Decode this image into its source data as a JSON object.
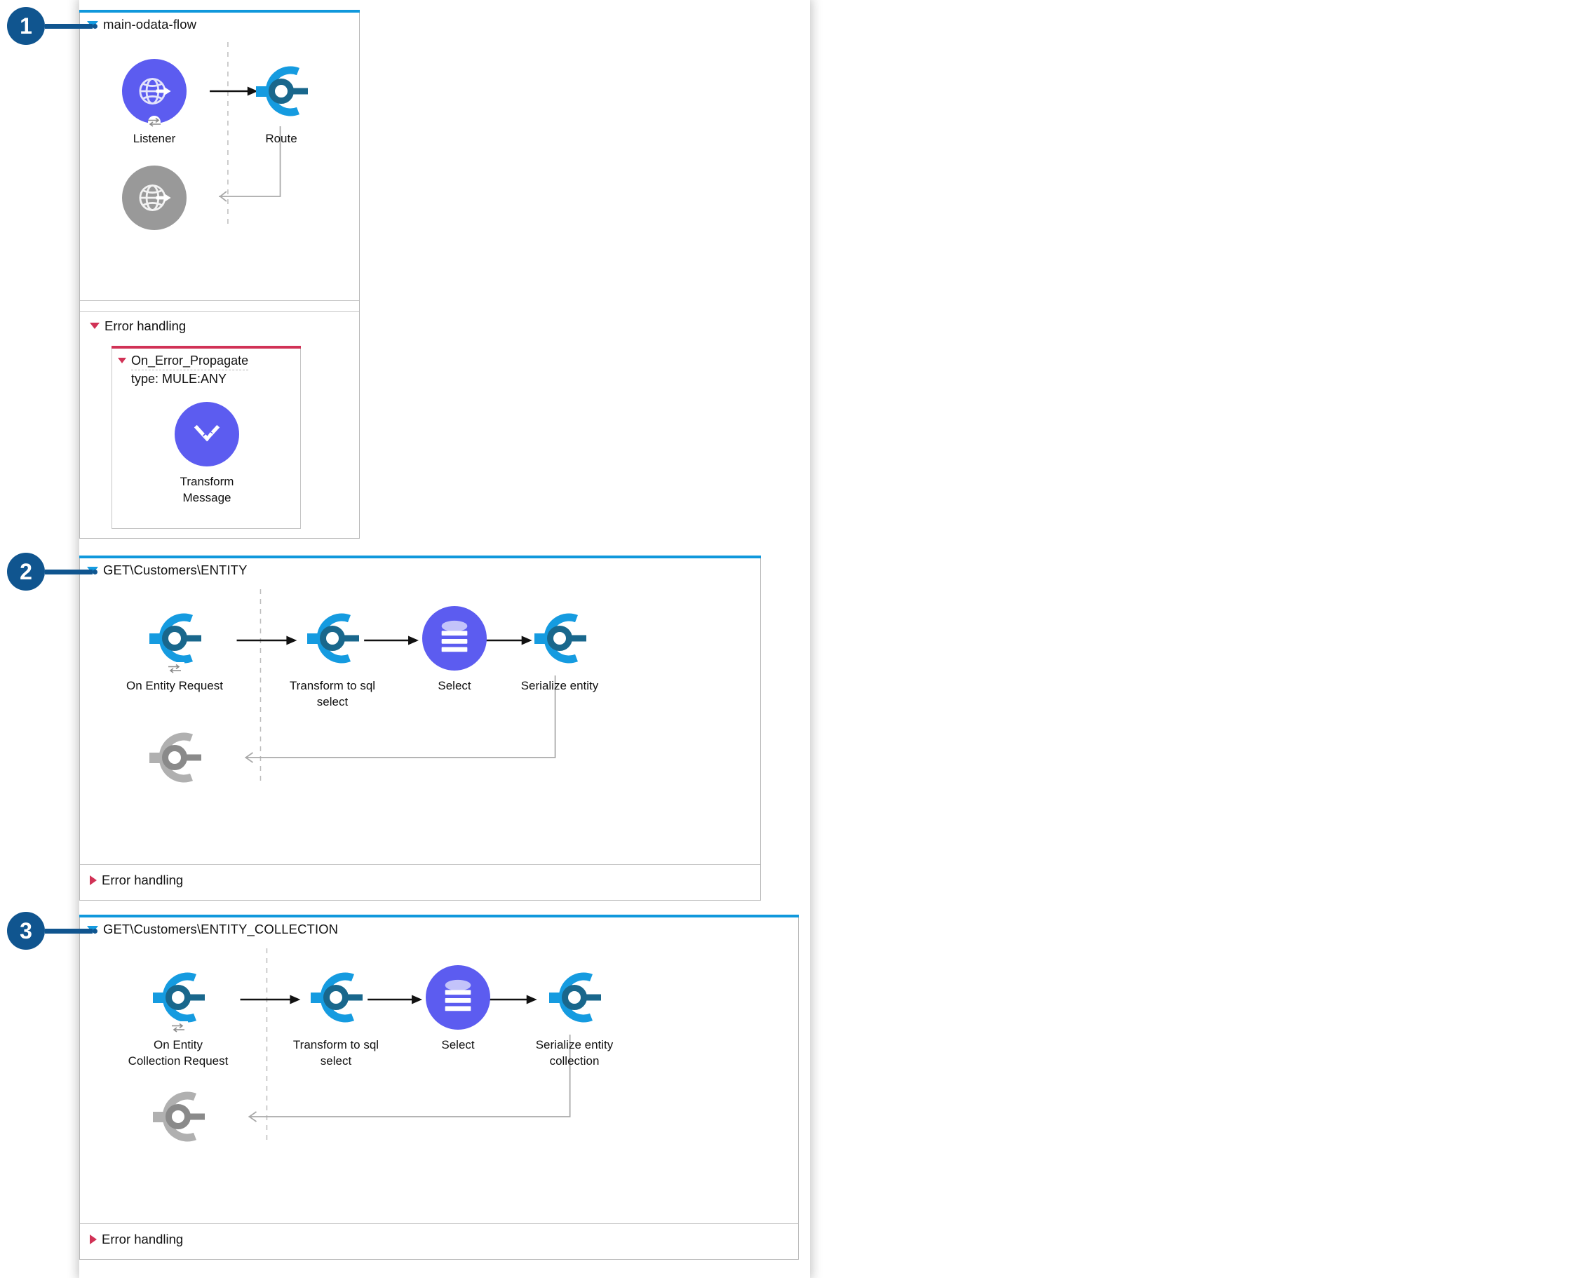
{
  "canvas": {
    "background_color": "#ffffff",
    "flow_accent_color": "#1098DC",
    "error_accent_color": "#D13256",
    "badge_color": "#10558F",
    "purple_icon_color": "#5C5CF0",
    "connector_blue": "#159BE0",
    "connector_dark_blue": "#19678C",
    "disabled_grey": "#999999"
  },
  "callouts": [
    {
      "number": "1",
      "target": "flow-main-odata"
    },
    {
      "number": "2",
      "target": "flow-get-customers-entity"
    },
    {
      "number": "3",
      "target": "flow-get-customers-entity-collection"
    }
  ],
  "flows": [
    {
      "id": "flow-main-odata",
      "title": "main-odata-flow",
      "expanded": true,
      "disclosure_icon": "triangle-down-icon",
      "nodes": [
        {
          "name": "listener",
          "label": "Listener",
          "icon": "http-listener-globe-icon",
          "style": "purple-circle",
          "source": true
        },
        {
          "name": "route",
          "label": "Route",
          "icon": "connector-c-icon",
          "style": "connector-blue"
        },
        {
          "name": "listener-response",
          "label": "",
          "icon": "http-listener-globe-icon",
          "style": "grey-circle"
        }
      ],
      "error_handling": {
        "label": "Error handling",
        "expanded": true,
        "disclosure_icon": "triangle-down-icon",
        "scope": {
          "name": "On_Error_Propagate",
          "type_line": "type: MULE:ANY",
          "disclosure_icon": "triangle-down-icon",
          "nodes": [
            {
              "name": "transform-message",
              "label": "Transform\nMessage",
              "icon": "dataweave-icon",
              "style": "purple-circle"
            }
          ]
        }
      }
    },
    {
      "id": "flow-get-customers-entity",
      "title": "GET\\Customers\\ENTITY",
      "expanded": true,
      "disclosure_icon": "triangle-down-icon",
      "nodes": [
        {
          "name": "on-entity-request",
          "label": "On Entity Request",
          "icon": "connector-c-icon",
          "style": "connector-blue",
          "source": true
        },
        {
          "name": "transform-to-sql-select",
          "label": "Transform to sql\nselect",
          "icon": "connector-c-icon",
          "style": "connector-blue"
        },
        {
          "name": "select",
          "label": "Select",
          "icon": "database-icon",
          "style": "purple-circle"
        },
        {
          "name": "serialize-entity",
          "label": "Serialize entity",
          "icon": "connector-c-icon",
          "style": "connector-blue"
        },
        {
          "name": "response",
          "label": "",
          "icon": "connector-c-icon",
          "style": "grey-connector"
        }
      ],
      "error_handling": {
        "label": "Error handling",
        "expanded": false,
        "disclosure_icon": "triangle-right-icon"
      }
    },
    {
      "id": "flow-get-customers-entity-collection",
      "title": "GET\\Customers\\ENTITY_COLLECTION",
      "expanded": true,
      "disclosure_icon": "triangle-down-icon",
      "nodes": [
        {
          "name": "on-entity-collection-request",
          "label": "On Entity\nCollection Request",
          "icon": "connector-c-icon",
          "style": "connector-blue",
          "source": true
        },
        {
          "name": "transform-to-sql-select",
          "label": "Transform to sql\nselect",
          "icon": "connector-c-icon",
          "style": "connector-blue"
        },
        {
          "name": "select",
          "label": "Select",
          "icon": "database-icon",
          "style": "purple-circle"
        },
        {
          "name": "serialize-entity-collection",
          "label": "Serialize entity\ncollection",
          "icon": "connector-c-icon",
          "style": "connector-blue"
        },
        {
          "name": "response",
          "label": "",
          "icon": "connector-c-icon",
          "style": "grey-connector"
        }
      ],
      "error_handling": {
        "label": "Error handling",
        "expanded": false,
        "disclosure_icon": "triangle-right-icon"
      }
    }
  ]
}
